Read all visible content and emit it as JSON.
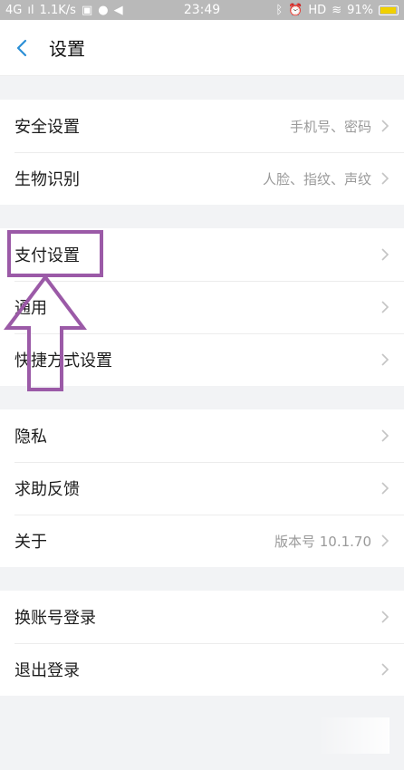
{
  "status_bar": {
    "network": "4G",
    "signal": "ıl",
    "speed": "1.1K/s",
    "time": "23:49",
    "hd": "HD",
    "battery": "91%"
  },
  "header": {
    "back_icon": "chevron-left-icon",
    "title": "设置"
  },
  "sections": [
    [
      {
        "label": "安全设置",
        "value": "手机号、密码"
      },
      {
        "label": "生物识别",
        "value": "人脸、指纹、声纹"
      }
    ],
    [
      {
        "label": "支付设置",
        "value": ""
      },
      {
        "label": "通用",
        "value": ""
      },
      {
        "label": "快捷方式设置",
        "value": ""
      }
    ],
    [
      {
        "label": "隐私",
        "value": ""
      },
      {
        "label": "求助反馈",
        "value": ""
      },
      {
        "label": "关于",
        "value": "版本号 10.1.70"
      }
    ],
    [
      {
        "label": "换账号登录",
        "value": ""
      },
      {
        "label": "退出登录",
        "value": ""
      }
    ]
  ],
  "colors": {
    "accent": "#2b8fd6",
    "annotation": "#9b5aa7",
    "background": "#f2f3f5"
  }
}
